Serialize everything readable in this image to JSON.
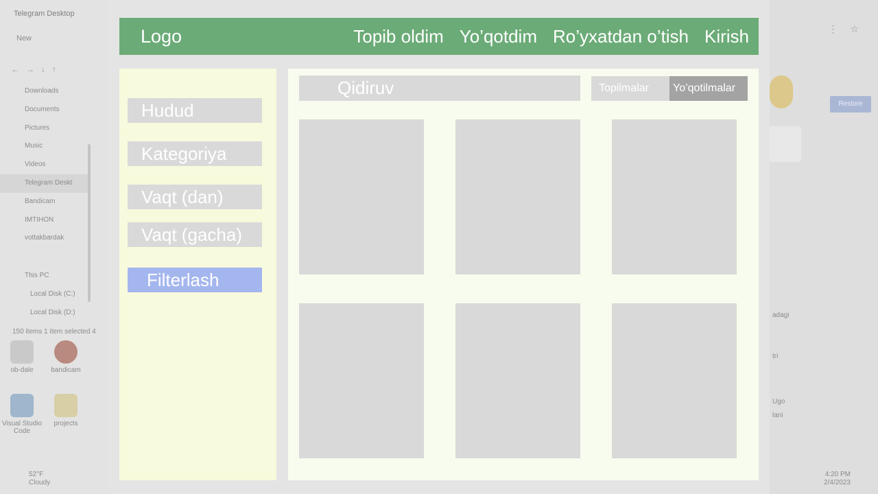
{
  "background": {
    "explorer": {
      "window_title": "Telegram Desktop",
      "new_button": "New",
      "quick_access": [
        "Downloads",
        "Documents",
        "Pictures",
        "Music",
        "Videos",
        "Telegram Deskt",
        "Bandicam",
        "IMTIHON",
        "vottakbardak"
      ],
      "this_pc": "This PC",
      "disks": [
        "Local Disk (C:)",
        "Local Disk (D:)"
      ],
      "status": "150 items    1 item selected  4"
    },
    "desktop_icons": [
      "ob-dale",
      "bandicam",
      "Visual Studio Code",
      "projects"
    ],
    "weather": {
      "temp": "52°F",
      "condition": "Cloudy"
    },
    "right_panel": {
      "button": "Restore",
      "snippets": [
        "adagi",
        "tri",
        "Ugo",
        "lani"
      ],
      "clock_time": "4:20 PM",
      "clock_date": "2/4/2023"
    }
  },
  "header": {
    "logo": "Logo",
    "nav": [
      "Topib oldim",
      "Yo’qotdim",
      "Ro’yxatdan o’tish",
      "Kirish"
    ]
  },
  "sidebar": {
    "fields": [
      "Hudud",
      "Kategoriya",
      "Vaqt (dan)",
      "Vaqt (gacha)"
    ],
    "filter_button": "Filterlash"
  },
  "main": {
    "search_placeholder": "Qidiruv",
    "tabs": [
      "Topilmalar",
      "Yo’qotilmalar"
    ],
    "active_tab": "Yo’qotilmalar",
    "card_count": 6
  },
  "colors": {
    "header_bg": "#6bab77",
    "sidebar_bg": "#f8fadd",
    "content_bg": "#f8fcee",
    "placeholder_gray": "#d9d9d9",
    "filter_button_bg": "#a4b6ee",
    "active_tab_bg": "#a3a3a3"
  }
}
